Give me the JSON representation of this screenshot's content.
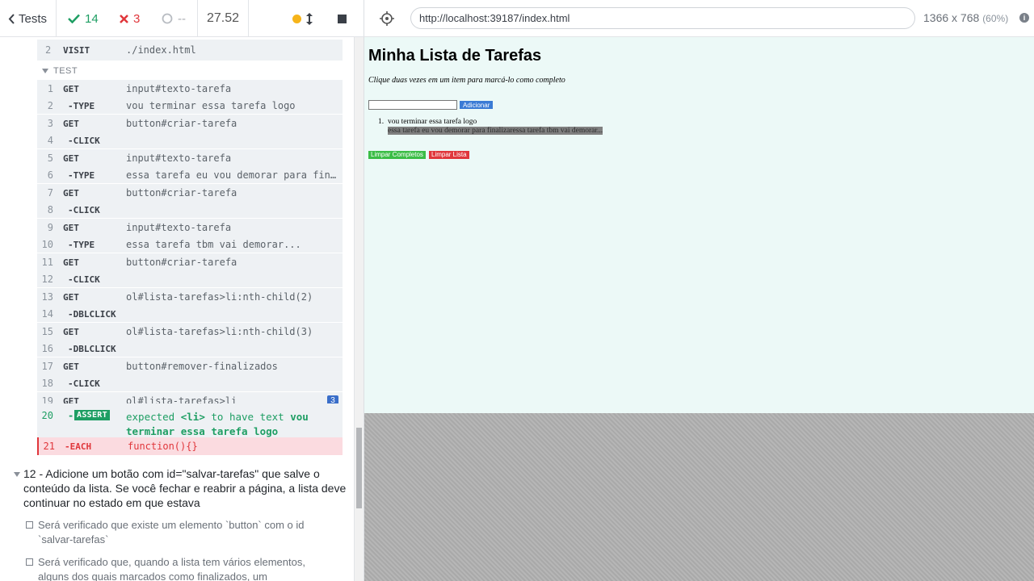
{
  "reporter": {
    "tests_label": "Tests",
    "passed": "14",
    "failed": "3",
    "pending": "--",
    "duration": "27.52"
  },
  "commands": {
    "visit": {
      "num": "2",
      "name": "VISIT",
      "arg": "./index.html"
    },
    "test_label": "TEST",
    "rows": [
      {
        "num": "1",
        "name": "GET",
        "arg": "input#texto-tarefa"
      },
      {
        "num": "2",
        "name": "-TYPE",
        "arg": "vou terminar essa tarefa logo"
      },
      {
        "num": "3",
        "name": "GET",
        "arg": "button#criar-tarefa"
      },
      {
        "num": "4",
        "name": "-CLICK",
        "arg": ""
      },
      {
        "num": "5",
        "name": "GET",
        "arg": "input#texto-tarefa"
      },
      {
        "num": "6",
        "name": "-TYPE",
        "arg": "essa tarefa eu vou demorar para finalizar"
      },
      {
        "num": "7",
        "name": "GET",
        "arg": "button#criar-tarefa"
      },
      {
        "num": "8",
        "name": "-CLICK",
        "arg": ""
      },
      {
        "num": "9",
        "name": "GET",
        "arg": "input#texto-tarefa"
      },
      {
        "num": "10",
        "name": "-TYPE",
        "arg": "essa tarefa tbm vai demorar..."
      },
      {
        "num": "11",
        "name": "GET",
        "arg": "button#criar-tarefa"
      },
      {
        "num": "12",
        "name": "-CLICK",
        "arg": ""
      },
      {
        "num": "13",
        "name": "GET",
        "arg": "ol#lista-tarefas>li:nth-child(2)"
      },
      {
        "num": "14",
        "name": "-DBLCLICK",
        "arg": ""
      },
      {
        "num": "15",
        "name": "GET",
        "arg": "ol#lista-tarefas>li:nth-child(3)"
      },
      {
        "num": "16",
        "name": "-DBLCLICK",
        "arg": ""
      },
      {
        "num": "17",
        "name": "GET",
        "arg": "button#remover-finalizados"
      },
      {
        "num": "18",
        "name": "-CLICK",
        "arg": ""
      },
      {
        "num": "19",
        "name": "GET",
        "arg": "ol#lista-tarefas>li",
        "badge": "3"
      }
    ],
    "assert": {
      "num": "20",
      "name": "ASSERT",
      "msg_prefix": "expected",
      "msg_tag": "<li>",
      "msg_middle": "to have text",
      "msg_value": "vou terminar essa tarefa logo"
    },
    "fail": {
      "num": "21",
      "name": "-EACH",
      "arg": "function(){}"
    }
  },
  "suite": {
    "title": "12 - Adicione um botão com id=\"salvar-tarefas\" que salve o conteúdo da lista. Se você fechar e reabrir a página, a lista deve continuar no estado em que estava",
    "checks": [
      "Será verificado que existe um elemento `button` com o id `salvar-tarefas`",
      "Será verificado que, quando a lista tem vários elementos, alguns dos quais marcados como finalizados, um"
    ]
  },
  "aut": {
    "url": "http://localhost:39187/index.html",
    "viewport": "1366 x 768",
    "scale": "(60%)",
    "info": "i"
  },
  "app": {
    "title": "Minha Lista de Tarefas",
    "subtitle": "Clique duas vezes em um item para marcá-lo como completo",
    "add_button": "Adicionar",
    "items": [
      "vou terminar essa tarefa logo",
      "essa tarefa eu vou demorar para finalizaressa tarefa tbm vai demorar..."
    ],
    "clear_completed": "Limpar Completos",
    "clear_list": "Limpar Lista"
  },
  "colors": {
    "passed": "#1e9e63",
    "failed": "#e0363b",
    "pending_dot": "#f6b41a",
    "aut_bg": "#ecf9f7",
    "add_button": "#3a7bd5",
    "clear_completed": "#3bbd46",
    "clear_list": "#e0363b"
  }
}
